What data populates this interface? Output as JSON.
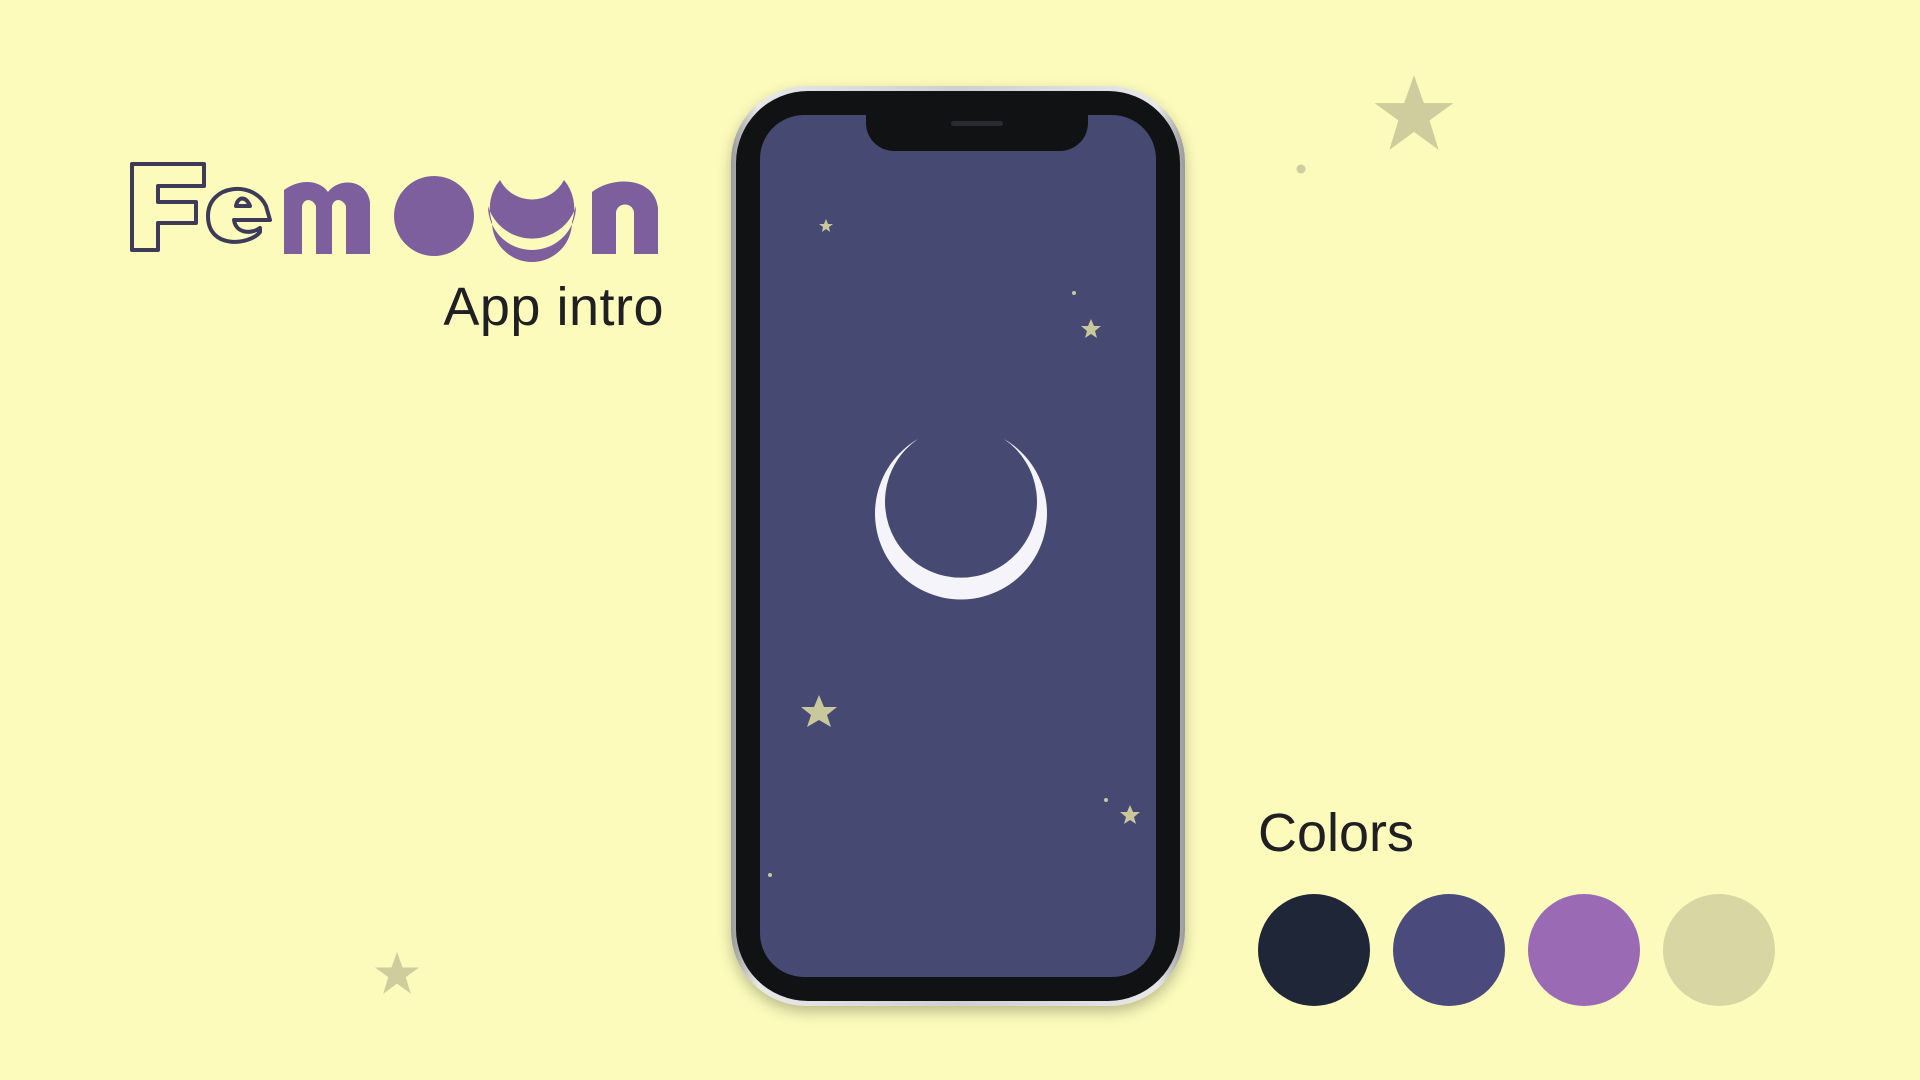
{
  "logo": {
    "text": "Femoon",
    "outline_part": "Fe",
    "fill_part": "moon",
    "outline_color": "#3e3a5a",
    "fill_color": "#7d5f9e"
  },
  "subtitle": "App intro",
  "phone_screen": {
    "background_color": "#464a72",
    "icon": "crescent-moon-icon",
    "icon_color": "#f5f4fb",
    "star_color": "#c8c89c"
  },
  "colors_section": {
    "title": "Colors",
    "swatches": [
      {
        "name": "dark-navy",
        "color": "#1f2638"
      },
      {
        "name": "indigo",
        "color": "#4a4a7d"
      },
      {
        "name": "purple",
        "color": "#9a6ab5"
      },
      {
        "name": "khaki",
        "color": "#d8d7a3"
      }
    ]
  },
  "background_color": "#fcfbbb",
  "decoration_star_color": "#cfcc9d"
}
